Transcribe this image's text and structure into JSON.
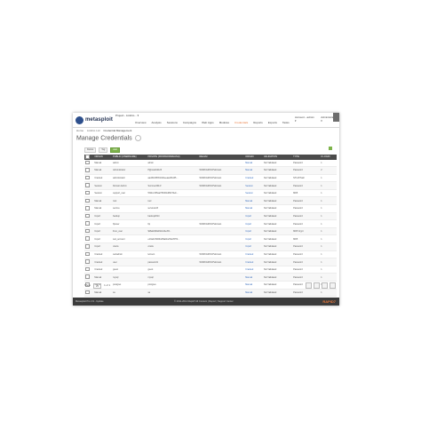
{
  "header": {
    "logo_text": "metasploit",
    "project": "Project - LinkCo... ▾",
    "nav": [
      "Overview",
      "Analysis",
      "Sessions",
      "Campaigns",
      "Web Apps",
      "Modules",
      "Credentials",
      "Reports",
      "Exports",
      "Tasks"
    ],
    "nav_active_index": 6,
    "account": "Account - admin ▾",
    "admin": "Administration ▾"
  },
  "breadcrumbs": [
    "Home",
    "LinkCo Ltd",
    "Credential Management"
  ],
  "page_title": "Manage Credentials",
  "toolbar": {
    "buttons": [
      "Delete",
      "Tag",
      "Add"
    ]
  },
  "table": {
    "columns": [
      "",
      "ORIGIN",
      "PUBLIC (USERNAME)",
      "PRIVATE (PASSWORD/HASH)",
      "REALM",
      "ORIGIN",
      "VALIDATION",
      "TYPE",
      "# LOGIN"
    ],
    "rows": [
      [
        "",
        "Manual",
        "admin",
        "admin",
        "",
        "Manual",
        "Not Validated",
        "Password",
        "1"
      ],
      [
        "",
        "Manual",
        "Administrator",
        "P@ssw0rd123",
        "WORKGROUP\\domain",
        "Manual",
        "Not Validated",
        "Password",
        "2"
      ],
      [
        "",
        "Cracked",
        "administrator",
        "aad3b435b51404eeaad3b435...",
        "WORKGROUP\\domain",
        "Cracked",
        "Not Validated",
        "NTLM Hash",
        "1"
      ],
      [
        "",
        "Session",
        "Domain Admin",
        "Summer2014!",
        "WORKGROUP\\domain",
        "Session",
        "Not Validated",
        "Password",
        "1"
      ],
      [
        "",
        "Session",
        "support_user",
        "5f4dcc3b5aa765d61d8327deb...",
        "",
        "Session",
        "Not Validated",
        "MD5",
        "1"
      ],
      [
        "",
        "Manual",
        "root",
        "toor",
        "",
        "Manual",
        "Not Validated",
        "Password",
        "1"
      ],
      [
        "",
        "Manual",
        "service",
        "service123",
        "",
        "Manual",
        "Not Validated",
        "Password",
        "1"
      ],
      [
        "",
        "Import",
        "backup",
        "backup2014",
        "",
        "Import",
        "Not Validated",
        "Password",
        "1"
      ],
      [
        "",
        "Import",
        "ftpuser",
        "ftp",
        "WORKGROUP\\domain",
        "Import",
        "Not Validated",
        "Password",
        "1"
      ],
      [
        "",
        "Import",
        "linux_user",
        "$1$abc$6ab9c1d2e3f4...",
        "",
        "Import",
        "Not Validated",
        "MD5 Crypt",
        "1"
      ],
      [
        "",
        "Import",
        "test_account",
        "e10adc3949ba59abbe56e057f2...",
        "",
        "Import",
        "Not Validated",
        "MD5",
        "1"
      ],
      [
        "",
        "Import",
        "oracle",
        "oracle",
        "",
        "Import",
        "Not Validated",
        "Password",
        "1"
      ],
      [
        "",
        "Cracked",
        "webadmin",
        "letmein",
        "WORKGROUP\\domain",
        "Cracked",
        "Not Validated",
        "Password",
        "1"
      ],
      [
        "",
        "Cracked",
        "user",
        "password1",
        "WORKGROUP\\domain",
        "Cracked",
        "Not Validated",
        "Password",
        "1"
      ],
      [
        "",
        "Cracked",
        "guest",
        "guest",
        "",
        "Cracked",
        "Not Validated",
        "Password",
        "1"
      ],
      [
        "",
        "Manual",
        "mysql",
        "mysql",
        "",
        "Manual",
        "Not Validated",
        "Password",
        "1"
      ],
      [
        "",
        "Manual",
        "postgres",
        "postgres",
        "",
        "Manual",
        "Not Validated",
        "Password",
        "1"
      ],
      [
        "",
        "Manual",
        "sa",
        "sa",
        "",
        "Manual",
        "Not Validated",
        "Password",
        "1"
      ],
      [
        "",
        "Manual",
        "tomcat",
        "tomcat",
        "",
        "Manual",
        "Not Validated",
        "Password",
        "1"
      ]
    ]
  },
  "pager": {
    "show_label": "Show",
    "per_page": "25",
    "page_text": "1 of 1"
  },
  "footer": {
    "left": "Metasploit Pro 4.9 - Update",
    "middle": "© 2011-2014 Rapid7 All Content | Report | Support Center",
    "brand": "RAPID7"
  }
}
